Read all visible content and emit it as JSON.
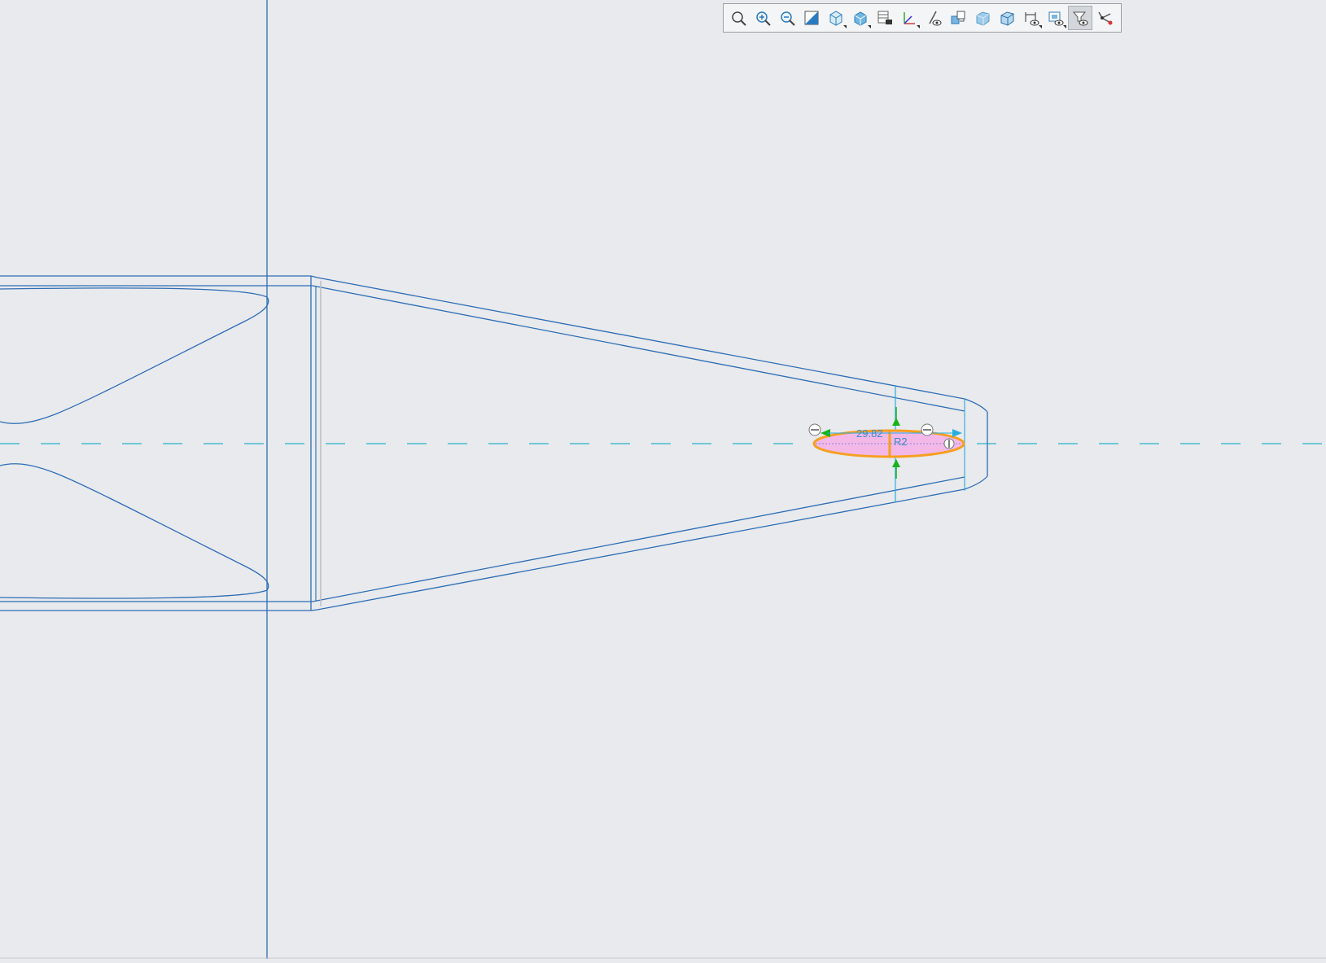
{
  "toolbar": {
    "buttons": [
      {
        "name": "zoom-to-fit",
        "icon": "zoom-fit-icon",
        "active": false,
        "dropdown": false
      },
      {
        "name": "zoom-in",
        "icon": "zoom-in-icon",
        "active": false,
        "dropdown": false
      },
      {
        "name": "zoom-out",
        "icon": "zoom-out-icon",
        "active": false,
        "dropdown": false
      },
      {
        "name": "section-view",
        "icon": "section-view-icon",
        "active": false,
        "dropdown": false
      },
      {
        "name": "view-orientation",
        "icon": "view-cube-icon",
        "active": false,
        "dropdown": true
      },
      {
        "name": "display-style",
        "icon": "display-style-icon",
        "active": false,
        "dropdown": true
      },
      {
        "name": "view-settings",
        "icon": "table-camera-icon",
        "active": false,
        "dropdown": false
      },
      {
        "name": "hide-show-items",
        "icon": "axis-icon",
        "active": false,
        "dropdown": true
      },
      {
        "name": "edit-appearance",
        "icon": "line-eye-icon",
        "active": false,
        "dropdown": false
      },
      {
        "name": "apply-scene",
        "icon": "swap-views-icon",
        "active": false,
        "dropdown": false
      },
      {
        "name": "shaded",
        "icon": "shaded-box-icon",
        "active": false,
        "dropdown": false
      },
      {
        "name": "shaded-edges",
        "icon": "shaded-edges-icon",
        "active": false,
        "dropdown": false
      },
      {
        "name": "dimension-visibility",
        "icon": "dimension-eye-icon",
        "active": false,
        "dropdown": true
      },
      {
        "name": "view-settings-2",
        "icon": "display-eye-icon",
        "active": false,
        "dropdown": true
      },
      {
        "name": "selection-filter",
        "icon": "filter-eye-icon",
        "active": true,
        "dropdown": false
      },
      {
        "name": "sketch-relations",
        "icon": "relations-icon",
        "active": false,
        "dropdown": false
      }
    ]
  },
  "colors": {
    "background": "#e8eaee",
    "sketch_line": "#2e6db4",
    "centerline": "#2ab3c8",
    "dimension": "#29aee0",
    "selection": "#f5a020",
    "selection_fill": "#f3b8e8",
    "arrow_green": "#17b31b"
  },
  "dimensions": {
    "length_label": "29.82",
    "radius_label": "R2"
  }
}
